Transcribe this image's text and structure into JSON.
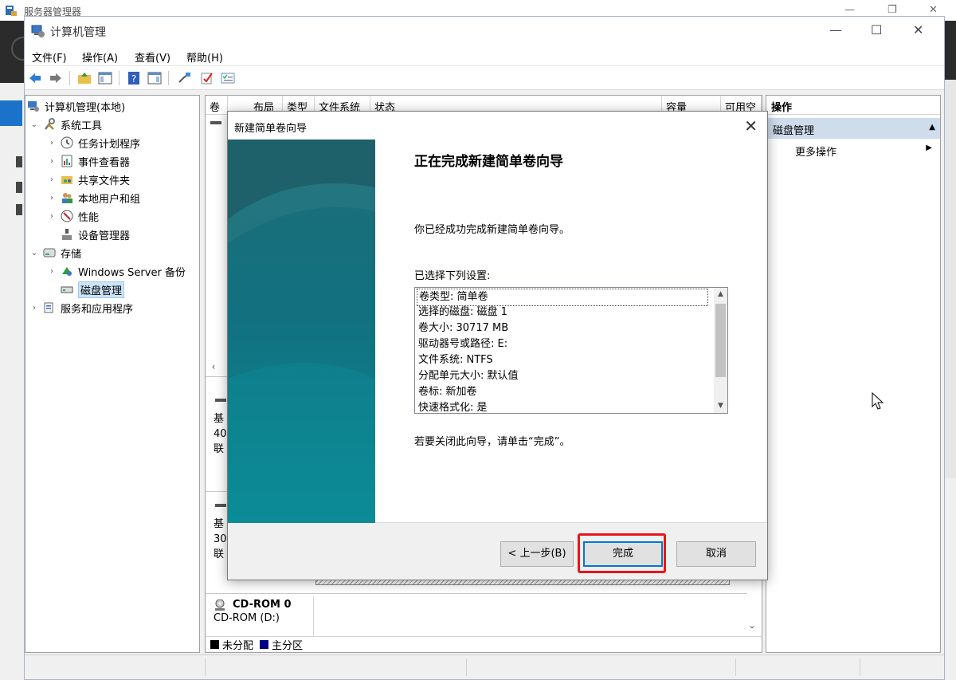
{
  "background_window": {
    "title": "服务器管理器"
  },
  "window": {
    "title": "计算机管理"
  },
  "menu": [
    "文件(F)",
    "操作(A)",
    "查看(V)",
    "帮助(H)"
  ],
  "tree": {
    "root": "计算机管理(本地)",
    "system_tools": "系统工具",
    "task_scheduler": "任务计划程序",
    "event_viewer": "事件查看器",
    "shared_folders": "共享文件夹",
    "local_users": "本地用户和组",
    "performance": "性能",
    "device_manager": "设备管理器",
    "storage": "存储",
    "windows_backup": "Windows Server 备份",
    "disk_management": "磁盘管理",
    "services_apps": "服务和应用程序"
  },
  "columns": [
    "卷",
    "布局",
    "类型",
    "文件系统",
    "状态",
    "容量",
    "可用空"
  ],
  "disks": [
    {
      "prefix": "基",
      "size": "40",
      "status": "联"
    },
    {
      "prefix": "基",
      "size": "30",
      "status": "联"
    }
  ],
  "cdrom": {
    "name": "CD-ROM 0",
    "drive": "CD-ROM (D:)"
  },
  "legend": {
    "unallocated": "未分配",
    "primary": "主分区",
    "unallocated_color": "#000000",
    "primary_color": "#000080"
  },
  "actions": {
    "header": "操作",
    "section": "磁盘管理",
    "more": "更多操作"
  },
  "wizard": {
    "title": "新建简单卷向导",
    "heading": "正在完成新建简单卷向导",
    "success_text": "你已经成功完成新建简单卷向导。",
    "selected_label": "已选择下列设置:",
    "settings": [
      "卷类型: 简单卷",
      "选择的磁盘: 磁盘 1",
      "卷大小: 30717 MB",
      "驱动器号或路径: E:",
      "文件系统: NTFS",
      "分配单元大小: 默认值",
      "卷标: 新加卷",
      "快速格式化: 是"
    ],
    "close_hint": "若要关闭此向导，请单击“完成”。",
    "back_button": "< 上一步(B)",
    "finish_button": "完成",
    "cancel_button": "取消"
  }
}
